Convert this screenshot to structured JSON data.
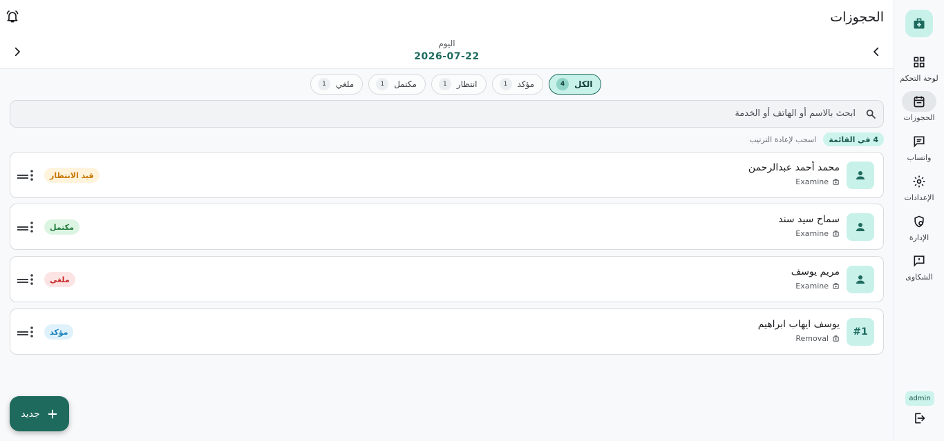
{
  "header": {
    "title": "الحجوزات",
    "date_label": "اليوم",
    "date_value": "2026-07-22"
  },
  "filters": [
    {
      "label": "الكل",
      "count": "4",
      "active": true
    },
    {
      "label": "مؤكد",
      "count": "1"
    },
    {
      "label": "انتظار",
      "count": "1"
    },
    {
      "label": "مكتمل",
      "count": "1"
    },
    {
      "label": "ملغي",
      "count": "1"
    }
  ],
  "search": {
    "placeholder": "ابحث بالاسم أو الهاتف أو الخدمة"
  },
  "list_meta": {
    "count_label": "4 في القائمة",
    "reorder_hint": "اسحب لإعادة الترتيب"
  },
  "bookings": [
    {
      "name": "محمد أحمد عبدالرحمن",
      "service": "Examine",
      "status": "قيد الانتظار",
      "avatar": "person-icon"
    },
    {
      "name": "سماح سيد سند",
      "service": "Examine",
      "status": "مكتمل",
      "avatar": "person-icon"
    },
    {
      "name": "مريم يوسف",
      "service": "Examine",
      "status": "ملغي",
      "avatar": "person-icon"
    },
    {
      "name": "يوسف ايهاب ابراهيم",
      "service": "Removal",
      "status": "مؤكد",
      "avatar_text": "#1"
    }
  ],
  "status_colors": {
    "pending": {
      "bg": "#fff3dc",
      "fg": "#c77700"
    },
    "completed": {
      "bg": "#dcf5e3",
      "fg": "#1f7a3a"
    },
    "cancelled": {
      "bg": "#fde4e4",
      "fg": "#c62828"
    },
    "confirmed": {
      "bg": "#dff2fb",
      "fg": "#1a82b8"
    }
  },
  "accent": "#1e6b5e",
  "nav": [
    {
      "label": "لوحة التحكم",
      "icon": "dashboard-icon"
    },
    {
      "label": "الحجوزات",
      "icon": "calendar-icon",
      "active": true
    },
    {
      "label": "واتساب",
      "icon": "chat-icon"
    },
    {
      "label": "الإعدادات",
      "icon": "gear-icon"
    },
    {
      "label": "الإدارة",
      "icon": "admin-shield-icon"
    },
    {
      "label": "الشكاوى",
      "icon": "feedback-icon"
    }
  ],
  "user": {
    "role": "admin"
  },
  "fab": {
    "label": "جديد"
  }
}
